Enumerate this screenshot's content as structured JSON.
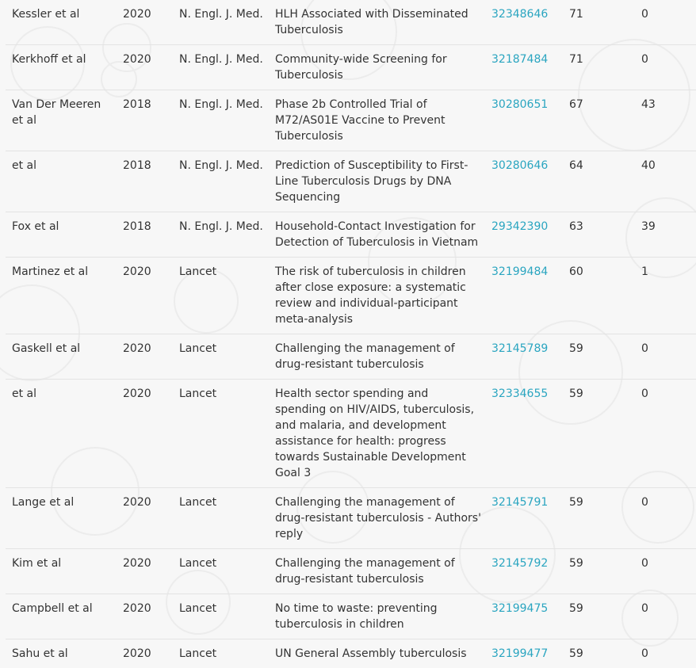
{
  "theme": {
    "background": "#f7f7f7",
    "text": "#333333",
    "link": "#2aa5c0",
    "divider": "#e3e3e3"
  },
  "rows": [
    {
      "author": "Kessler et al",
      "year": "2020",
      "journal": "N. Engl. J. Med.",
      "title": "HLH Associated with Disseminated Tuberculosis",
      "pmid": "32348646",
      "cites": "71",
      "other": "0"
    },
    {
      "author": "Kerkhoff et al",
      "year": "2020",
      "journal": "N. Engl. J. Med.",
      "title": "Community-wide Screening for Tuberculosis",
      "pmid": "32187484",
      "cites": "71",
      "other": "0"
    },
    {
      "author": "Van Der Meeren et al",
      "year": "2018",
      "journal": "N. Engl. J. Med.",
      "title": "Phase 2b Controlled Trial of M72/AS01E Vaccine to Prevent Tuberculosis",
      "pmid": "30280651",
      "cites": "67",
      "other": "43"
    },
    {
      "author": "et al",
      "year": "2018",
      "journal": "N. Engl. J. Med.",
      "title": "Prediction of Susceptibility to First-Line Tuberculosis Drugs by DNA Sequencing",
      "pmid": "30280646",
      "cites": "64",
      "other": "40"
    },
    {
      "author": "Fox et al",
      "year": "2018",
      "journal": "N. Engl. J. Med.",
      "title": "Household-Contact Investigation for Detection of Tuberculosis in Vietnam",
      "pmid": "29342390",
      "cites": "63",
      "other": "39"
    },
    {
      "author": "Martinez et al",
      "year": "2020",
      "journal": "Lancet",
      "title": "The risk of tuberculosis in children after close exposure: a systematic review and individual-participant meta-analysis",
      "pmid": "32199484",
      "cites": "60",
      "other": "1"
    },
    {
      "author": "Gaskell et al",
      "year": "2020",
      "journal": "Lancet",
      "title": "Challenging the management of drug-resistant tuberculosis",
      "pmid": "32145789",
      "cites": "59",
      "other": "0"
    },
    {
      "author": "et al",
      "year": "2020",
      "journal": "Lancet",
      "title": "Health sector spending and spending on HIV/AIDS, tuberculosis, and malaria, and development assistance for health: progress towards Sustainable Development Goal 3",
      "pmid": "32334655",
      "cites": "59",
      "other": "0"
    },
    {
      "author": "Lange et al",
      "year": "2020",
      "journal": "Lancet",
      "title": "Challenging the management of drug-resistant tuberculosis - Authors' reply",
      "pmid": "32145791",
      "cites": "59",
      "other": "0"
    },
    {
      "author": "Kim et al",
      "year": "2020",
      "journal": "Lancet",
      "title": "Challenging the management of drug-resistant tuberculosis",
      "pmid": "32145792",
      "cites": "59",
      "other": "0"
    },
    {
      "author": "Campbell et al",
      "year": "2020",
      "journal": "Lancet",
      "title": "No time to waste: preventing tuberculosis in children",
      "pmid": "32199475",
      "cites": "59",
      "other": "0"
    },
    {
      "author": "Sahu et al",
      "year": "2020",
      "journal": "Lancet",
      "title": "UN General Assembly tuberculosis",
      "pmid": "32199477",
      "cites": "59",
      "other": "0"
    }
  ]
}
